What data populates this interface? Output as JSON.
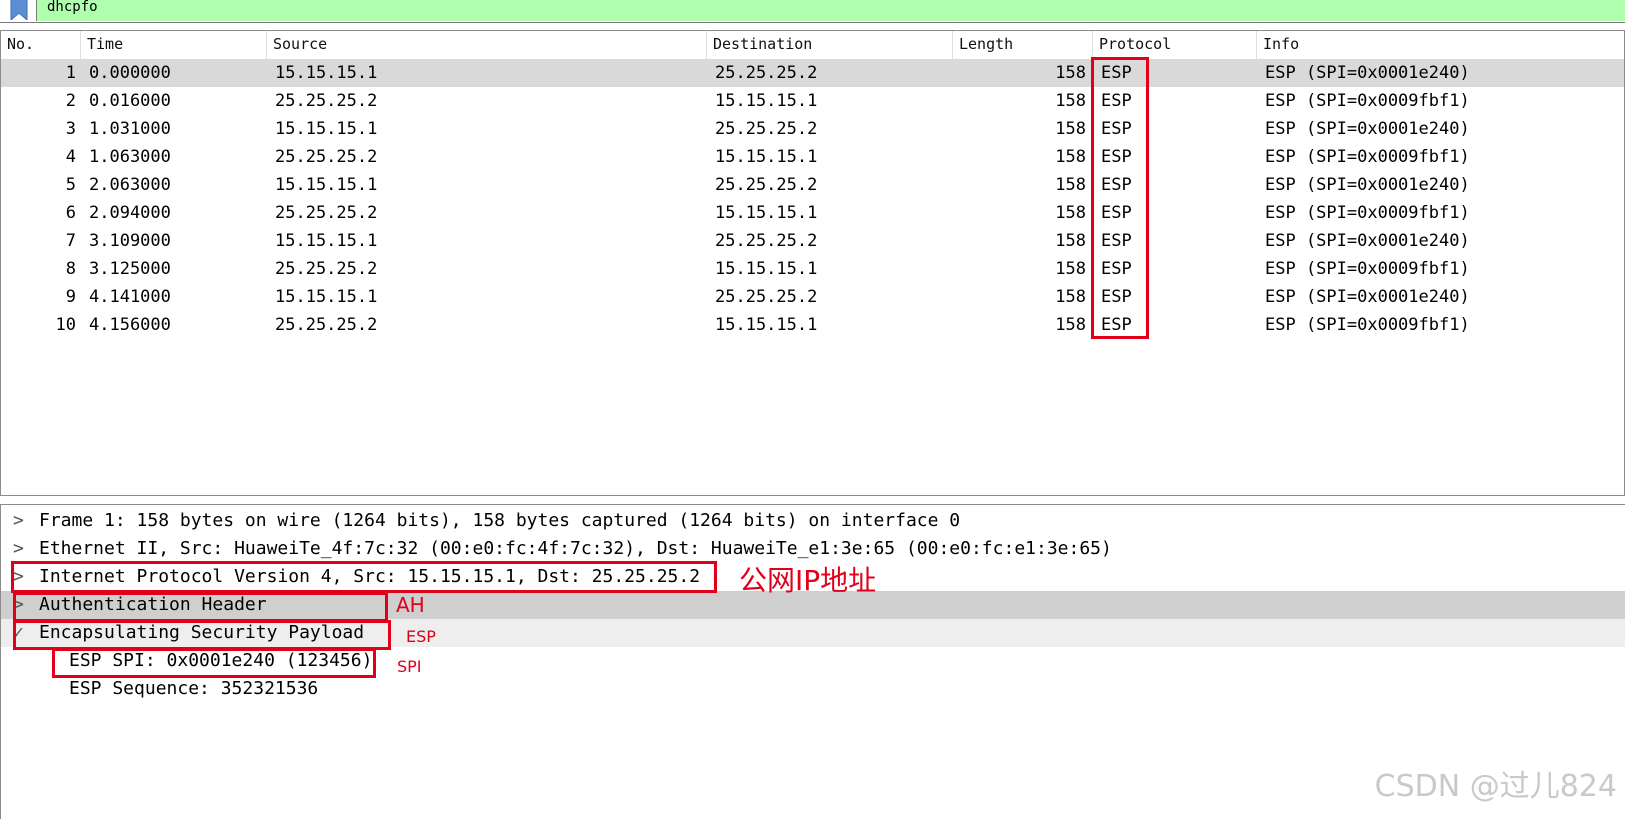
{
  "filter": {
    "value": "dhcpfo"
  },
  "columns": [
    "No.",
    "Time",
    "Source",
    "Destination",
    "Length",
    "Protocol",
    "Info"
  ],
  "packets": [
    {
      "no": "1",
      "time": "0.000000",
      "src": "15.15.15.1",
      "dst": "25.25.25.2",
      "len": "158",
      "proto": "ESP",
      "info": "ESP (SPI=0x0001e240)"
    },
    {
      "no": "2",
      "time": "0.016000",
      "src": "25.25.25.2",
      "dst": "15.15.15.1",
      "len": "158",
      "proto": "ESP",
      "info": "ESP (SPI=0x0009fbf1)"
    },
    {
      "no": "3",
      "time": "1.031000",
      "src": "15.15.15.1",
      "dst": "25.25.25.2",
      "len": "158",
      "proto": "ESP",
      "info": "ESP (SPI=0x0001e240)"
    },
    {
      "no": "4",
      "time": "1.063000",
      "src": "25.25.25.2",
      "dst": "15.15.15.1",
      "len": "158",
      "proto": "ESP",
      "info": "ESP (SPI=0x0009fbf1)"
    },
    {
      "no": "5",
      "time": "2.063000",
      "src": "15.15.15.1",
      "dst": "25.25.25.2",
      "len": "158",
      "proto": "ESP",
      "info": "ESP (SPI=0x0001e240)"
    },
    {
      "no": "6",
      "time": "2.094000",
      "src": "25.25.25.2",
      "dst": "15.15.15.1",
      "len": "158",
      "proto": "ESP",
      "info": "ESP (SPI=0x0009fbf1)"
    },
    {
      "no": "7",
      "time": "3.109000",
      "src": "15.15.15.1",
      "dst": "25.25.25.2",
      "len": "158",
      "proto": "ESP",
      "info": "ESP (SPI=0x0001e240)"
    },
    {
      "no": "8",
      "time": "3.125000",
      "src": "25.25.25.2",
      "dst": "15.15.15.1",
      "len": "158",
      "proto": "ESP",
      "info": "ESP (SPI=0x0009fbf1)"
    },
    {
      "no": "9",
      "time": "4.141000",
      "src": "15.15.15.1",
      "dst": "25.25.25.2",
      "len": "158",
      "proto": "ESP",
      "info": "ESP (SPI=0x0001e240)"
    },
    {
      "no": "10",
      "time": "4.156000",
      "src": "25.25.25.2",
      "dst": "15.15.15.1",
      "len": "158",
      "proto": "ESP",
      "info": "ESP (SPI=0x0009fbf1)"
    }
  ],
  "details": [
    {
      "arrow": ">",
      "text": "Frame 1: 158 bytes on wire (1264 bits), 158 bytes captured (1264 bits) on interface 0"
    },
    {
      "arrow": ">",
      "text": "Ethernet II, Src: HuaweiTe_4f:7c:32 (00:e0:fc:4f:7c:32), Dst: HuaweiTe_e1:3e:65 (00:e0:fc:e1:3e:65)"
    },
    {
      "arrow": ">",
      "text": "Internet Protocol Version 4, Src: 15.15.15.1, Dst: 25.25.25.2"
    },
    {
      "arrow": ">",
      "text": "Authentication Header"
    },
    {
      "arrow": "✓",
      "text": "Encapsulating Security Payload"
    },
    {
      "arrow": "",
      "text": "ESP SPI: 0x0001e240 (123456)"
    },
    {
      "arrow": "",
      "text": "ESP Sequence: 352321536"
    }
  ],
  "annotations": {
    "ip": "公网IP地址",
    "ah": "AH",
    "esp": "ESP",
    "spi": "SPI"
  },
  "watermark": "CSDN @过儿824",
  "colors": {
    "filter_ok": "#afffaf",
    "annotation": "#e0001a",
    "selected_row": "#d9d9d9"
  }
}
